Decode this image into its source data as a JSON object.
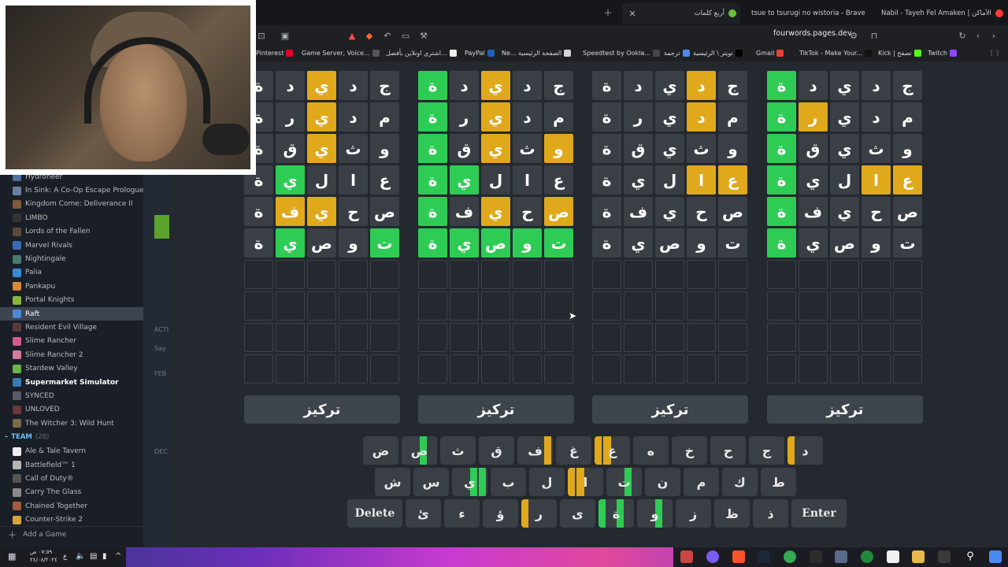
{
  "steam": {
    "games": [
      {
        "name": "Hydroneer",
        "icon_color": "#4a6fa5"
      },
      {
        "name": "In Sink: A Co-Op Escape Prologue",
        "icon_color": "#6b7fa0"
      },
      {
        "name": "Kingdom Come: Deliverance II",
        "icon_color": "#7a5a3a"
      },
      {
        "name": "LIMBO",
        "icon_color": "#333333"
      },
      {
        "name": "Lords of the Fallen",
        "icon_color": "#5a4a3a"
      },
      {
        "name": "Marvel Rivals",
        "icon_color": "#3a6ab5"
      },
      {
        "name": "Nightingale",
        "icon_color": "#4a7a6a"
      },
      {
        "name": "Palia",
        "icon_color": "#3a8ad5"
      },
      {
        "name": "Pankapu",
        "icon_color": "#d58a3a"
      },
      {
        "name": "Portal Knights",
        "icon_color": "#8ab53a"
      },
      {
        "name": "Raft",
        "icon_color": "#4a8ad5",
        "active": true
      },
      {
        "name": "Resident Evil Village",
        "icon_color": "#5a3a3a"
      },
      {
        "name": "Slime Rancher",
        "icon_color": "#d55a8a"
      },
      {
        "name": "Slime Rancher 2",
        "icon_color": "#d57a9a"
      },
      {
        "name": "Stardew Valley",
        "icon_color": "#6ab54a"
      },
      {
        "name": "Supermarket Simulator",
        "icon_color": "#3a7ab5",
        "bold": true
      },
      {
        "name": "SYNCED",
        "icon_color": "#5a5a6a"
      },
      {
        "name": "UNLOVED",
        "icon_color": "#6a3a3a"
      },
      {
        "name": "The Witcher 3: Wild Hunt",
        "icon_color": "#7a6a4a"
      }
    ],
    "team_label": "TEAM",
    "team_count": "(26)",
    "team_games": [
      {
        "name": "Ale & Tale Tavern",
        "icon_color": "#eeeeee"
      },
      {
        "name": "Battlefield™ 1",
        "icon_color": "#b5b5b5"
      },
      {
        "name": "Call of Duty®",
        "icon_color": "#555555"
      },
      {
        "name": "Carry The Glass",
        "icon_color": "#8a8a8a"
      },
      {
        "name": "Chained Together",
        "icon_color": "#a55a3a"
      },
      {
        "name": "Counter-Strike 2",
        "icon_color": "#d5a53a"
      }
    ],
    "add_game": "Add a Game",
    "mid_labels": [
      "ACTI",
      "Say",
      "FEB",
      "DEC"
    ]
  },
  "browser": {
    "tabs": [
      {
        "title": "Nabil - Tayeh Fel Amaken | الأماكن",
        "dot_color": "#ff3b30"
      },
      {
        "title": "tsue to tsurugi no wistoria - Brave Se",
        "dot_color": "#ff5b3b"
      },
      {
        "title": "أربع كلمات",
        "dot_color": "#6abf3a"
      }
    ],
    "url": "fourwords.pages.dev",
    "bookmarks": [
      {
        "label": "Pinterest",
        "color": "#e60023"
      },
      {
        "label": "Game Server, Voice...",
        "color": "#555555"
      },
      {
        "label": "اشتري اونلاين بأفضل...",
        "color": "#eeeeee"
      },
      {
        "label": "PayPal",
        "color": "#1b5fbf"
      },
      {
        "label": "Ne... الصفحة الرئيسية",
        "color": "#d5d5d5"
      },
      {
        "label": "Speedtest by Ookla...",
        "color": "#444444"
      },
      {
        "label": "ترجمة",
        "color": "#4a8af4"
      },
      {
        "label": "تويتر \\ الرئيسية",
        "color": "#000000"
      },
      {
        "label": "Gmail",
        "color": "#ea4335"
      },
      {
        "label": "TikTok - Make Your...",
        "color": "#111111"
      },
      {
        "label": "Kick | تصفح",
        "color": "#53fc18"
      },
      {
        "label": "Twitch",
        "color": "#9146ff"
      }
    ]
  },
  "game": {
    "boards": [
      {
        "rows": [
          [
            {
              "ch": "ج",
              "s": "x"
            },
            {
              "ch": "د",
              "s": "x"
            },
            {
              "ch": "ي",
              "s": "y"
            },
            {
              "ch": "د",
              "s": "x"
            },
            {
              "ch": "ة",
              "s": "x"
            }
          ],
          [
            {
              "ch": "م",
              "s": "x"
            },
            {
              "ch": "د",
              "s": "x"
            },
            {
              "ch": "ي",
              "s": "y"
            },
            {
              "ch": "ر",
              "s": "x"
            },
            {
              "ch": "ة",
              "s": "x"
            }
          ],
          [
            {
              "ch": "و",
              "s": "x"
            },
            {
              "ch": "ث",
              "s": "x"
            },
            {
              "ch": "ي",
              "s": "y"
            },
            {
              "ch": "ق",
              "s": "x"
            },
            {
              "ch": "ة",
              "s": "x"
            }
          ],
          [
            {
              "ch": "ع",
              "s": "x"
            },
            {
              "ch": "ا",
              "s": "x"
            },
            {
              "ch": "ل",
              "s": "x"
            },
            {
              "ch": "ي",
              "s": "g"
            },
            {
              "ch": "ة",
              "s": "x"
            }
          ],
          [
            {
              "ch": "ص",
              "s": "x"
            },
            {
              "ch": "ح",
              "s": "x"
            },
            {
              "ch": "ي",
              "s": "y"
            },
            {
              "ch": "ف",
              "s": "y"
            },
            {
              "ch": "ة",
              "s": "x"
            }
          ],
          [
            {
              "ch": "ت",
              "s": "g"
            },
            {
              "ch": "و",
              "s": "x"
            },
            {
              "ch": "ص",
              "s": "x"
            },
            {
              "ch": "ي",
              "s": "g"
            },
            {
              "ch": "ة",
              "s": "x"
            }
          ]
        ],
        "focus_label": "تركيز"
      },
      {
        "rows": [
          [
            {
              "ch": "ج",
              "s": "x"
            },
            {
              "ch": "د",
              "s": "x"
            },
            {
              "ch": "ي",
              "s": "y"
            },
            {
              "ch": "د",
              "s": "x"
            },
            {
              "ch": "ة",
              "s": "g"
            }
          ],
          [
            {
              "ch": "م",
              "s": "x"
            },
            {
              "ch": "د",
              "s": "x"
            },
            {
              "ch": "ي",
              "s": "y"
            },
            {
              "ch": "ر",
              "s": "x"
            },
            {
              "ch": "ة",
              "s": "g"
            }
          ],
          [
            {
              "ch": "و",
              "s": "y"
            },
            {
              "ch": "ث",
              "s": "x"
            },
            {
              "ch": "ي",
              "s": "y"
            },
            {
              "ch": "ق",
              "s": "x"
            },
            {
              "ch": "ة",
              "s": "g"
            }
          ],
          [
            {
              "ch": "ع",
              "s": "x"
            },
            {
              "ch": "ا",
              "s": "x"
            },
            {
              "ch": "ل",
              "s": "x"
            },
            {
              "ch": "ي",
              "s": "g"
            },
            {
              "ch": "ة",
              "s": "g"
            }
          ],
          [
            {
              "ch": "ص",
              "s": "y"
            },
            {
              "ch": "ح",
              "s": "x"
            },
            {
              "ch": "ي",
              "s": "y"
            },
            {
              "ch": "ف",
              "s": "x"
            },
            {
              "ch": "ة",
              "s": "g"
            }
          ],
          [
            {
              "ch": "ت",
              "s": "g"
            },
            {
              "ch": "و",
              "s": "g"
            },
            {
              "ch": "ص",
              "s": "g"
            },
            {
              "ch": "ي",
              "s": "g"
            },
            {
              "ch": "ة",
              "s": "g"
            }
          ]
        ],
        "focus_label": "تركيز"
      },
      {
        "rows": [
          [
            {
              "ch": "ج",
              "s": "x"
            },
            {
              "ch": "د",
              "s": "y"
            },
            {
              "ch": "ي",
              "s": "x"
            },
            {
              "ch": "د",
              "s": "x"
            },
            {
              "ch": "ة",
              "s": "x"
            }
          ],
          [
            {
              "ch": "م",
              "s": "x"
            },
            {
              "ch": "د",
              "s": "y"
            },
            {
              "ch": "ي",
              "s": "x"
            },
            {
              "ch": "ر",
              "s": "x"
            },
            {
              "ch": "ة",
              "s": "x"
            }
          ],
          [
            {
              "ch": "و",
              "s": "x"
            },
            {
              "ch": "ث",
              "s": "x"
            },
            {
              "ch": "ي",
              "s": "x"
            },
            {
              "ch": "ق",
              "s": "x"
            },
            {
              "ch": "ة",
              "s": "x"
            }
          ],
          [
            {
              "ch": "ع",
              "s": "y"
            },
            {
              "ch": "ا",
              "s": "y"
            },
            {
              "ch": "ل",
              "s": "x"
            },
            {
              "ch": "ي",
              "s": "x"
            },
            {
              "ch": "ة",
              "s": "x"
            }
          ],
          [
            {
              "ch": "ص",
              "s": "x"
            },
            {
              "ch": "ح",
              "s": "x"
            },
            {
              "ch": "ي",
              "s": "x"
            },
            {
              "ch": "ف",
              "s": "x"
            },
            {
              "ch": "ة",
              "s": "x"
            }
          ],
          [
            {
              "ch": "ت",
              "s": "x"
            },
            {
              "ch": "و",
              "s": "x"
            },
            {
              "ch": "ص",
              "s": "x"
            },
            {
              "ch": "ي",
              "s": "x"
            },
            {
              "ch": "ة",
              "s": "x"
            }
          ]
        ],
        "focus_label": "تركيز"
      },
      {
        "rows": [
          [
            {
              "ch": "ج",
              "s": "x"
            },
            {
              "ch": "د",
              "s": "x"
            },
            {
              "ch": "ي",
              "s": "x"
            },
            {
              "ch": "د",
              "s": "x"
            },
            {
              "ch": "ة",
              "s": "g"
            }
          ],
          [
            {
              "ch": "م",
              "s": "x"
            },
            {
              "ch": "د",
              "s": "x"
            },
            {
              "ch": "ي",
              "s": "x"
            },
            {
              "ch": "ر",
              "s": "y"
            },
            {
              "ch": "ة",
              "s": "g"
            }
          ],
          [
            {
              "ch": "و",
              "s": "x"
            },
            {
              "ch": "ث",
              "s": "x"
            },
            {
              "ch": "ي",
              "s": "x"
            },
            {
              "ch": "ق",
              "s": "x"
            },
            {
              "ch": "ة",
              "s": "g"
            }
          ],
          [
            {
              "ch": "ع",
              "s": "y"
            },
            {
              "ch": "ا",
              "s": "y"
            },
            {
              "ch": "ل",
              "s": "x"
            },
            {
              "ch": "ي",
              "s": "x"
            },
            {
              "ch": "ة",
              "s": "g"
            }
          ],
          [
            {
              "ch": "ص",
              "s": "x"
            },
            {
              "ch": "ح",
              "s": "x"
            },
            {
              "ch": "ي",
              "s": "x"
            },
            {
              "ch": "ف",
              "s": "x"
            },
            {
              "ch": "ة",
              "s": "g"
            }
          ],
          [
            {
              "ch": "ت",
              "s": "x"
            },
            {
              "ch": "و",
              "s": "x"
            },
            {
              "ch": "ص",
              "s": "x"
            },
            {
              "ch": "ي",
              "s": "x"
            },
            {
              "ch": "ة",
              "s": "g"
            }
          ]
        ],
        "focus_label": "تركيز"
      }
    ],
    "keyboard": [
      [
        {
          "k": "د",
          "q": [
            "x",
            "x",
            "x",
            "y"
          ]
        },
        {
          "k": "ج",
          "q": [
            "x",
            "x",
            "x",
            "x"
          ]
        },
        {
          "k": "ح",
          "q": [
            "x",
            "x",
            "x",
            "x"
          ]
        },
        {
          "k": "خ",
          "q": [
            "x",
            "x",
            "x",
            "x"
          ]
        },
        {
          "k": "ه",
          "q": [
            "x",
            "x",
            "x",
            "x"
          ]
        },
        {
          "k": "ع",
          "q": [
            "x",
            "x",
            "y",
            "y"
          ]
        },
        {
          "k": "غ",
          "q": [
            "x",
            "x",
            "x",
            "x"
          ]
        },
        {
          "k": "ف",
          "q": [
            "y",
            "x",
            "x",
            "x"
          ]
        },
        {
          "k": "ق",
          "q": [
            "x",
            "x",
            "x",
            "x"
          ]
        },
        {
          "k": "ث",
          "q": [
            "x",
            "x",
            "x",
            "x"
          ]
        },
        {
          "k": "ص",
          "q": [
            "x",
            "g",
            "x",
            "x"
          ]
        },
        {
          "k": "ض",
          "q": [
            "x",
            "x",
            "x",
            "x"
          ]
        }
      ],
      [
        {
          "k": "ط",
          "q": [
            "x",
            "x",
            "x",
            "x"
          ]
        },
        {
          "k": "ك",
          "q": [
            "x",
            "x",
            "x",
            "x"
          ]
        },
        {
          "k": "م",
          "q": [
            "x",
            "x",
            "x",
            "x"
          ]
        },
        {
          "k": "ن",
          "q": [
            "x",
            "x",
            "x",
            "x"
          ]
        },
        {
          "k": "ت",
          "q": [
            "x",
            "g",
            "x",
            "x"
          ]
        },
        {
          "k": "ا",
          "q": [
            "x",
            "x",
            "y",
            "y"
          ]
        },
        {
          "k": "ل",
          "q": [
            "x",
            "x",
            "x",
            "x"
          ]
        },
        {
          "k": "ب",
          "q": [
            "x",
            "x",
            "x",
            "x"
          ]
        },
        {
          "k": "ي",
          "q": [
            "g",
            "g",
            "x",
            "x"
          ]
        },
        {
          "k": "س",
          "q": [
            "x",
            "x",
            "x",
            "x"
          ]
        },
        {
          "k": "ش",
          "q": [
            "x",
            "x",
            "x",
            "x"
          ]
        }
      ],
      [
        {
          "k": "Enter",
          "wide": true
        },
        {
          "k": "ذ",
          "q": [
            "x",
            "x",
            "x",
            "x"
          ]
        },
        {
          "k": "ظ",
          "q": [
            "x",
            "x",
            "x",
            "x"
          ]
        },
        {
          "k": "ز",
          "q": [
            "x",
            "x",
            "x",
            "x"
          ]
        },
        {
          "k": "و",
          "q": [
            "x",
            "g",
            "x",
            "x"
          ]
        },
        {
          "k": "ة",
          "q": [
            "x",
            "g",
            "x",
            "g"
          ]
        },
        {
          "k": "ى",
          "q": [
            "x",
            "x",
            "x",
            "x"
          ]
        },
        {
          "k": "ر",
          "q": [
            "x",
            "x",
            "x",
            "y"
          ]
        },
        {
          "k": "ؤ",
          "q": [
            "x",
            "x",
            "x",
            "x"
          ]
        },
        {
          "k": "ء",
          "q": [
            "x",
            "x",
            "x",
            "x"
          ]
        },
        {
          "k": "ئ",
          "q": [
            "x",
            "x",
            "x",
            "x"
          ]
        },
        {
          "k": "Delete",
          "wide": true
        }
      ]
    ]
  },
  "taskbar": {
    "time": "٠٧:٥٩ ص",
    "date": "٢٤/٠٨/٢٠٢٤",
    "lang": "ع"
  }
}
